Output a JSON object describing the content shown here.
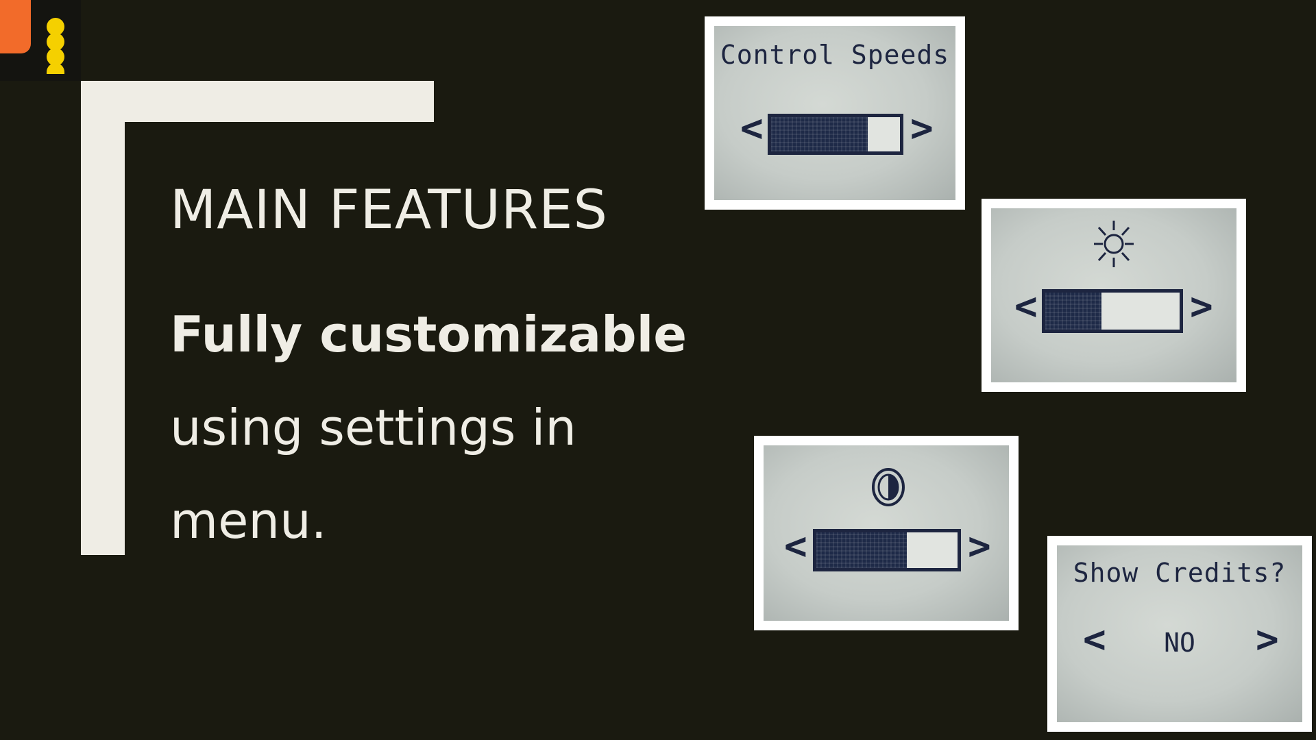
{
  "colors": {
    "background": "#1a1a10",
    "frame": "#efede5",
    "logo_orange": "#f26b2a",
    "logo_yellow": "#f5d000",
    "lcd_ink": "#1d2540"
  },
  "slide": {
    "title": "MAIN FEATURES",
    "body_strong": "Fully customizable",
    "body_line1": "using settings in",
    "body_line2": "menu."
  },
  "screens": [
    {
      "name": "control-speeds",
      "title": "Control Speeds",
      "left_arrow": "<",
      "right_arrow": ">",
      "level": 0.75
    },
    {
      "name": "brightness",
      "icon": "sun-icon",
      "left_arrow": "<",
      "right_arrow": ">",
      "level": 0.42
    },
    {
      "name": "contrast",
      "icon": "contrast-icon",
      "left_arrow": "<",
      "right_arrow": ">",
      "level": 0.64
    },
    {
      "name": "show-credits",
      "title": "Show Credits?",
      "left_arrow": "<",
      "value": "NO",
      "right_arrow": ">"
    }
  ]
}
